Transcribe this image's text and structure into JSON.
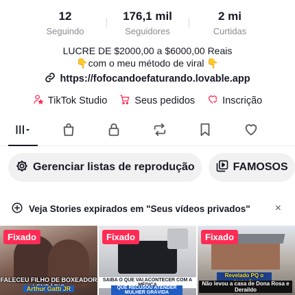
{
  "profile": {
    "stats": [
      {
        "value": "12",
        "label": "Seguindo"
      },
      {
        "value": "176,1 mil",
        "label": "Seguidores"
      },
      {
        "value": "2 mi",
        "label": "Curtidas"
      }
    ],
    "bio_line1": "LUCRE DE $2000,00 a $6000,00 Reais",
    "bio_line2": "👇com o meu método de viral 👇",
    "link": "https://fofocandoefaturando.lovable.app"
  },
  "tools": {
    "studio": "TikTok Studio",
    "orders": "Seus pedidos",
    "subscription": "Inscrição"
  },
  "tabs": [
    "videos-grid",
    "shop-bag",
    "lock",
    "repost",
    "bookmark",
    "heart"
  ],
  "chips": {
    "playlists": "Gerenciar listas de reprodução",
    "famous": "FAMOSOS"
  },
  "banner": {
    "text": "Veja Stories expirados em \"Seus vídeos privados\"",
    "close": "×"
  },
  "videos": [
    {
      "pinned": "Fixado",
      "caption1": "FALECEU FILHO DE BOXEADOR LENDÁRIO",
      "caption2": "Arthur Gatti JR"
    },
    {
      "pinned": "Fixado",
      "caption1": "SAIBA O QUE VAI ACONTECER COM A MÉDICA",
      "caption2": "QUE RECUSOU ATENDER MULHER GRÁVIDA"
    },
    {
      "pinned": "Fixado",
      "caption1": "Revelado PQ o tornado",
      "caption2": "Não levou a casa de Dona Rosa e Deraildo"
    }
  ],
  "colors": {
    "accent": "#fe2c55",
    "text": "#161823",
    "muted": "#8a8b91",
    "chip_bg": "#f1f1f2"
  }
}
